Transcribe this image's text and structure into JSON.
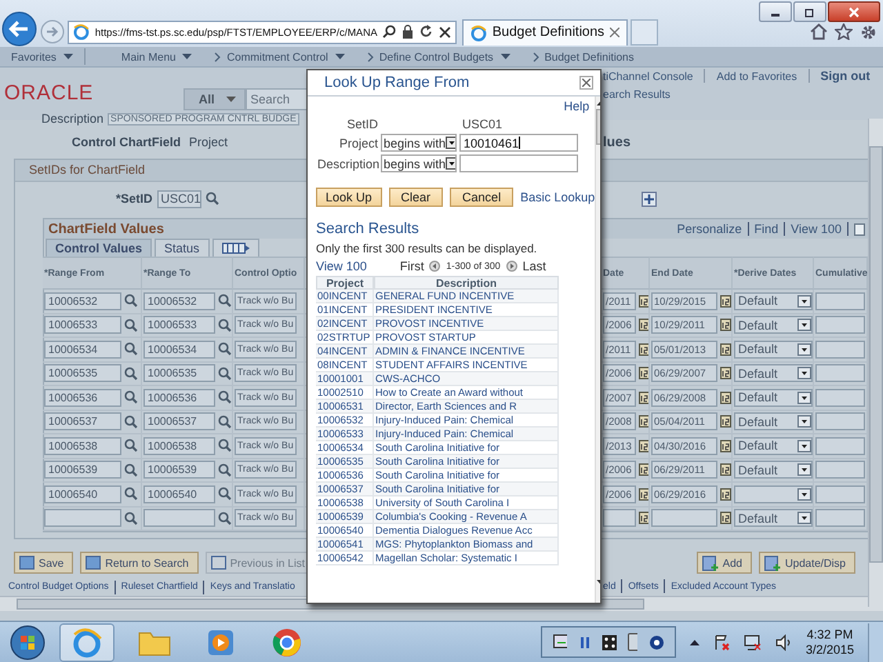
{
  "browser": {
    "address": "https://fms-tst.ps.sc.edu/psp/FTST/EMPLOYEE/ERP/c/MANA",
    "tab": "Budget Definitions"
  },
  "breadcrumbs": [
    {
      "label": "Favorites",
      "menu": true
    },
    {
      "label": "Main Menu",
      "menu": true
    },
    {
      "label": "Commitment Control",
      "menu": true
    },
    {
      "label": "Define Control Budgets",
      "menu": true
    },
    {
      "label": "Budget Definitions",
      "menu": false
    }
  ],
  "header": {
    "logo": "ORACLE",
    "search_scope": "All",
    "search_placeholder": "Search",
    "links": [
      "tiChannel Console",
      "Add to Favorites",
      "Sign out"
    ],
    "sublink": "earch Results"
  },
  "page": {
    "description_label": "Description",
    "description_value": "SPONSORED PROGRAM CNTRL BUDGE",
    "chartfield_label": "Control ChartField",
    "chartfield_value": "Project",
    "right_fragment": "lues"
  },
  "setids": {
    "title": "SetIDs for ChartField",
    "setid_label": "*SetID",
    "setid_value": "USC01"
  },
  "grid": {
    "title": "ChartField Values",
    "nav": [
      "Personalize",
      "Find",
      "View 100"
    ],
    "tabs": [
      {
        "label": "Control Values",
        "selected": true
      },
      {
        "label": "Status",
        "selected": false
      }
    ],
    "columns": [
      "*Range From",
      "*Range To",
      "Control Optio",
      "Date",
      "End Date",
      "*Derive Dates",
      "Cumulative"
    ],
    "rows": [
      {
        "from": "10006532",
        "to": "10006532",
        "option": "Track w/o Bu",
        "begin": "/2011",
        "end": "10/29/2015",
        "derive": "Default"
      },
      {
        "from": "10006533",
        "to": "10006533",
        "option": "Track w/o Bu",
        "begin": "/2006",
        "end": "10/29/2011",
        "derive": "Default"
      },
      {
        "from": "10006534",
        "to": "10006534",
        "option": "Track w/o Bu",
        "begin": "/2011",
        "end": "05/01/2013",
        "derive": "Default"
      },
      {
        "from": "10006535",
        "to": "10006535",
        "option": "Track w/o Bu",
        "begin": "/2006",
        "end": "06/29/2007",
        "derive": "Default"
      },
      {
        "from": "10006536",
        "to": "10006536",
        "option": "Track w/o Bu",
        "begin": "/2007",
        "end": "06/29/2008",
        "derive": "Default"
      },
      {
        "from": "10006537",
        "to": "10006537",
        "option": "Track w/o Bu",
        "begin": "/2008",
        "end": "05/04/2011",
        "derive": "Default"
      },
      {
        "from": "10006538",
        "to": "10006538",
        "option": "Track w/o Bu",
        "begin": "/2013",
        "end": "04/30/2016",
        "derive": "Default"
      },
      {
        "from": "10006539",
        "to": "10006539",
        "option": "Track w/o Bu",
        "begin": "/2006",
        "end": "06/29/2011",
        "derive": "Default"
      },
      {
        "from": "10006540",
        "to": "10006540",
        "option": "Track w/o Bu",
        "begin": "/2006",
        "end": "06/29/2016"
      },
      {
        "option": "Track w/o Bu",
        "derive": "Default"
      }
    ]
  },
  "buttons_left": [
    {
      "label": "Save",
      "disabled": false
    },
    {
      "label": "Return to Search",
      "disabled": false
    },
    {
      "label": "Previous in List",
      "disabled": true
    }
  ],
  "buttons_right": [
    {
      "label": "Add"
    },
    {
      "label": "Update/Disp"
    }
  ],
  "links_left": [
    "Control Budget Options",
    "Ruleset Chartfield",
    "Keys and Translatio"
  ],
  "links_right": [
    "eld",
    "Offsets",
    "Excluded Account Types"
  ],
  "modal": {
    "title": "Look Up Range From",
    "help": "Help",
    "setid_label": "SetID",
    "setid_value": "USC01",
    "criteria": [
      {
        "label": "Project",
        "operator": "begins with",
        "value": "10010461"
      },
      {
        "label": "Description",
        "operator": "begins with"
      }
    ],
    "buttons": [
      "Look Up",
      "Clear",
      "Cancel"
    ],
    "basic_lookup": "Basic Lookup",
    "results_title": "Search Results",
    "note": "Only the first 300 results can be displayed.",
    "view": "View 100",
    "first": "First",
    "range": "1-300 of 300",
    "last": "Last",
    "columns": [
      "Project",
      "Description"
    ],
    "results": [
      {
        "project": "00INCENT",
        "description": "GENERAL FUND INCENTIVE"
      },
      {
        "project": "01INCENT",
        "description": "PRESIDENT INCENTIVE"
      },
      {
        "project": "02INCENT",
        "description": "PROVOST INCENTIVE"
      },
      {
        "project": "02STRTUP",
        "description": "PROVOST STARTUP"
      },
      {
        "project": "04INCENT",
        "description": "ADMIN & FINANCE INCENTIVE"
      },
      {
        "project": "08INCENT",
        "description": "STUDENT AFFAIRS INCENTIVE"
      },
      {
        "project": "10001001",
        "description": "CWS-ACHCO"
      },
      {
        "project": "10002510",
        "description": "How to Create an Award without"
      },
      {
        "project": "10006531",
        "description": "Director, Earth Sciences and R"
      },
      {
        "project": "10006532",
        "description": "Injury-Induced Pain: Chemical"
      },
      {
        "project": "10006533",
        "description": "Injury-Induced Pain: Chemical"
      },
      {
        "project": "10006534",
        "description": "South Carolina Initiative for"
      },
      {
        "project": "10006535",
        "description": "South Carolina Initiative for"
      },
      {
        "project": "10006536",
        "description": "South Carolina Initiative for"
      },
      {
        "project": "10006537",
        "description": "South Carolina Initiative for"
      },
      {
        "project": "10006538",
        "description": "University of South Carolina I"
      },
      {
        "project": "10006539",
        "description": "Columbia's Cooking - Revenue A"
      },
      {
        "project": "10006540",
        "description": "Dementia Dialogues Revenue Acc"
      },
      {
        "project": "10006541",
        "description": "MGS: Phytoplankton Biomass and"
      },
      {
        "project": "10006542",
        "description": "Magellan Scholar: Systematic I"
      }
    ]
  },
  "taskbar": {
    "time": "4:32 PM",
    "date": "3/2/2015"
  }
}
